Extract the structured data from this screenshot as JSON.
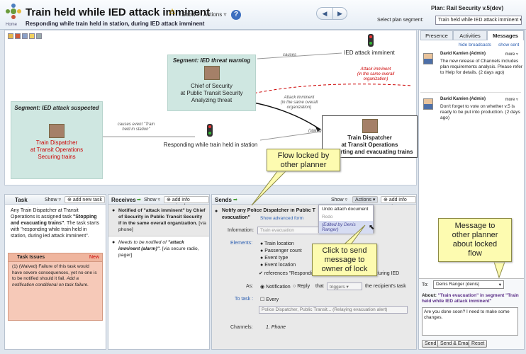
{
  "header": {
    "home_label": "Home",
    "title": "Train held while IED attack imminent",
    "subtitle": "Responding while train held in station, during IED attack imminent",
    "show_menu": "Show",
    "actions_menu": "Actions",
    "plan_name": "Plan: Rail Security v.5(dev)",
    "segment_label": "Select plan segment:",
    "segment_value": "Train held while IED attack imminent"
  },
  "flow": {
    "seg_threat_title": "Segment: IED threat warning",
    "seg_suspected_title": "Segment: IED attack suspected",
    "node_chief": "Chief of Security\nat Public Transit Security\nAnalyzing threat",
    "node_ied_imminent": "IED attack imminent",
    "node_responding": "Responding while train held in station",
    "node_dispatcher_left": "Train Dispatcher\nat Transit Operations\nSecuring trains",
    "node_dispatcher_right": "Train Dispatcher\nat Transit Operations\nReporting and evacuating trains",
    "note_causes": "causes",
    "note_attack_red": "Attack imminent\n(in the same overall\norganization)",
    "note_attack_black": "Attack imminent\n(in the same overall\norganization)",
    "note_causes_event": "causes event \"Train\nheld in station\"",
    "note_starts": "(starts)"
  },
  "callouts": {
    "flow_locked": "Flow locked by\nother planner",
    "click_send": "Click to send\nmessage to\nowner of lock",
    "message_planner": "Message to\nother planner\nabout locked\nflow"
  },
  "task_panel": {
    "title": "Task",
    "show": "Show",
    "add_new": "add new task",
    "desc_a": "Any Train Dispatcher at Transit Operations is assigned task ",
    "desc_b": "\"Stopping and evacuating trains\"",
    "desc_c": ". The task starts with \"responding while train held in station, during ied attack imminent\".",
    "issues_title": "Task Issues",
    "issues_new": "New",
    "issue_a": "(1) (Waived) Failure of this task would have severe consequences, yet no one is to be notified should it fail. ",
    "issue_b": "Add a notification conditional on task failure."
  },
  "receives_panel": {
    "title": "Receives",
    "show": "Show",
    "add_info": "add info received",
    "item1_a": "Notified of \"attack imminent\" by Chief of Security in Public Transit Security if in the same overall organization.",
    "item1_via": " [via phone]",
    "item2_pre": "Needs to be notified of ",
    "item2_bold": "\"attack imminent (alarm)\"",
    "item2_via": ". [via secure radio, pager]"
  },
  "sends_panel": {
    "title": "Sends",
    "show": "Show",
    "actions": "Actions",
    "add_info": "add info sent",
    "item_title_a": "Notify any Police Dispatcher in Public T",
    "item_title_b": "evacuation\"",
    "show_form": "Show advanced form",
    "information_label": "Information:",
    "information_value": "Train evacuation",
    "elements_label": "Elements:",
    "elements": [
      "Train location",
      "Passenger count",
      "Event type",
      "Event location"
    ],
    "references": "references \"Responding while train held in station, during IED",
    "as_label": "As:",
    "notification": "Notification",
    "reply": "Reply",
    "that": "that",
    "triggers": "triggers",
    "recipient_task": "the recipient's task",
    "to_task_label": "To task :",
    "every": "Every",
    "to_task_value": "Police Dispatcher, Public Transit... (Relaying evacuation alert)",
    "channels_label": "Channels:",
    "channel_1": "1.  Phone",
    "menu_undo": "Undo attach document",
    "menu_redo": "Redo",
    "menu_edited": "(Edited by Denis Ranger)"
  },
  "right_panel": {
    "tabs": [
      "Presence",
      "Activities",
      "Messages"
    ],
    "hide_broadcasts": "hide broadcasts",
    "show_sent": "show sent",
    "messages": [
      {
        "author": "David Kamien (Admin)",
        "more": "more",
        "text": "The new release of Channels includes plan requirements analysis. Please refer to Help for details. (2 days ago)"
      },
      {
        "author": "David Kamien (Admin)",
        "more": "more",
        "text": "Don't forget to vote on whether v.5 is ready to be put into production. (2 days ago)"
      }
    ],
    "to_label": "To:",
    "to_value": "Denis Ranger (denis)",
    "about_a": "About: ",
    "about_b": "\"Train evacuation\" in segment \"Train held while IED attack imminent\"",
    "message_text": "Are you done soon? I need to make some changes.",
    "send": "Send",
    "send_email": "Send & Email",
    "reset": "Reset"
  }
}
